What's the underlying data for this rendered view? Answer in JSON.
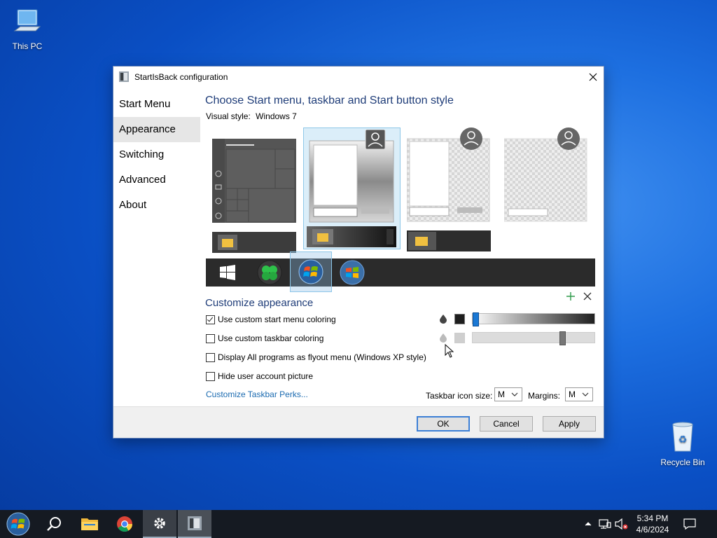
{
  "desktop": {
    "icons": [
      {
        "label": "This PC"
      },
      {
        "label": "Recycle Bin"
      }
    ]
  },
  "window": {
    "title": "StartIsBack configuration",
    "nav": [
      {
        "label": "Start Menu"
      },
      {
        "label": "Appearance",
        "active": true
      },
      {
        "label": "Switching"
      },
      {
        "label": "Advanced"
      },
      {
        "label": "About"
      }
    ],
    "style_heading": "Choose Start menu, taskbar and Start button style",
    "visual_style_label": "Visual style:",
    "visual_style_value": "Windows 7",
    "customize_heading": "Customize appearance",
    "options": [
      {
        "label": "Use custom start menu coloring",
        "checked": true
      },
      {
        "label": "Use custom taskbar coloring",
        "checked": false
      },
      {
        "label": "Display All programs as flyout menu (Windows XP style)",
        "checked": false
      },
      {
        "label": "Hide user account picture",
        "checked": false
      }
    ],
    "sliders": [
      {
        "level": 0.0,
        "color": "#1e1e1e"
      },
      {
        "level": 0.75,
        "color": "#cfcfcf"
      }
    ],
    "link_label": "Customize Taskbar Perks...",
    "icon_size_label": "Taskbar icon size:",
    "icon_size_value": "M",
    "margins_label": "Margins:",
    "margins_value": "M",
    "buttons": {
      "ok": "OK",
      "cancel": "Cancel",
      "apply": "Apply"
    },
    "accent": "#1e3c78"
  },
  "taskbar": {
    "time": "5:34 PM",
    "date": "4/6/2024"
  }
}
